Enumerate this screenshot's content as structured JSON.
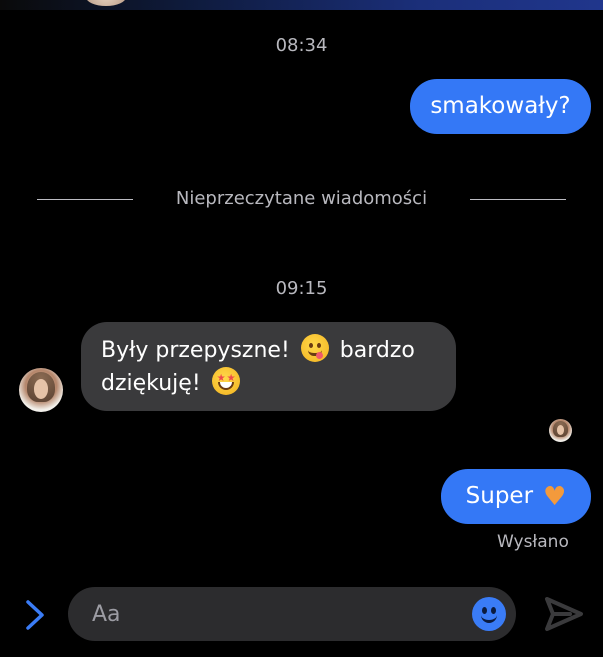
{
  "thread": {
    "time_1": "08:34",
    "msg_out_1": "smakowały?",
    "unread_divider": "Nieprzeczytane wiadomości",
    "time_2": "09:15",
    "msg_in_1_line1_a": "Były przepyszne!",
    "msg_in_1_line1_b": "bardzo",
    "msg_in_1_line2": "dziękuję!",
    "msg_out_2": "Super",
    "msg_out_2_emoji": "heart-orange",
    "status": "Wysłano"
  },
  "composer": {
    "placeholder": "Aa"
  },
  "colors": {
    "outgoing_bubble": "#3478f6",
    "incoming_bubble": "#3a3a3c",
    "background": "#000000",
    "accent": "#3a7cf6"
  }
}
